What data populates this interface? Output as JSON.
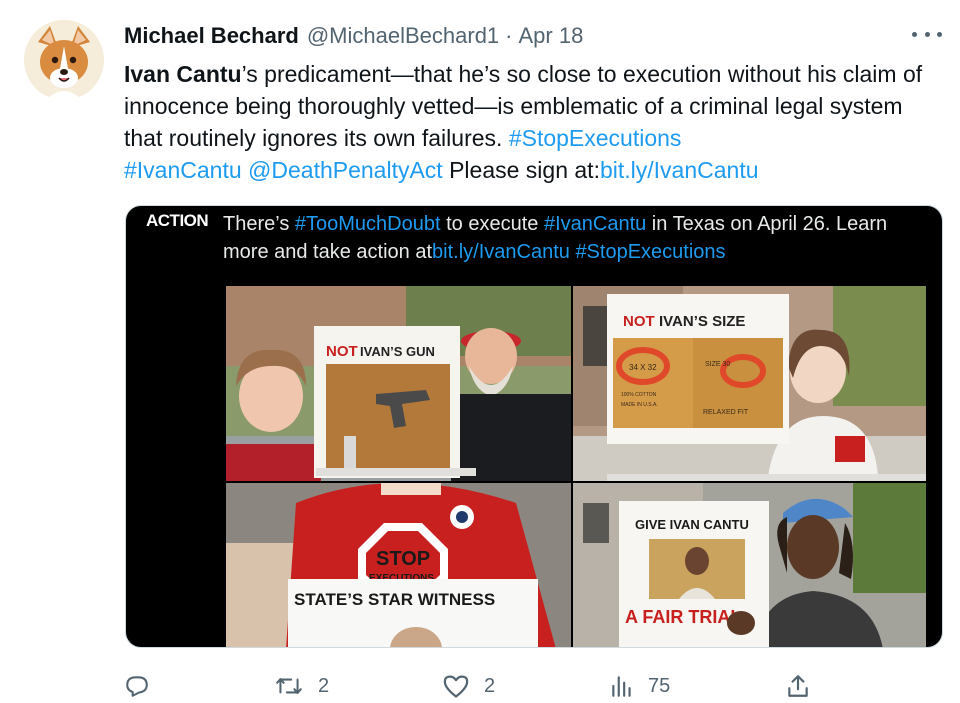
{
  "tweet": {
    "author_name": "Michael Bechard",
    "author_handle": "@MichaelBechard1",
    "separator": "·",
    "date": "Apr 18",
    "text": {
      "lead_bold": "Ivan Cantu",
      "body": "’s predicament—that he’s so close to execution without his claim of innocence being thoroughly vetted—is emblematic of a criminal legal system that routinely ignores its own failures. ",
      "hashtag1": "#StopExecutions",
      "hashtag2": "#IvanCantu",
      "mention": "@DeathPenaltyAct",
      "plain": " Please sign at:",
      "link": "bit.ly/IvanCantu"
    }
  },
  "media": {
    "logo": "ACTION",
    "caption": {
      "part1": "There’s ",
      "tag1": "#TooMuchDoubt",
      "part2": " to execute ",
      "tag2": "#IvanCantu",
      "part3": " in Texas on April 26.  Learn more and take action at",
      "link": "bit.ly/IvanCantu",
      "space": " ",
      "tag3": "#StopExecutions"
    },
    "signs": {
      "gun_not": "NOT",
      "gun_rest": " IVAN’S GUN",
      "size_not": "NOT",
      "size_rest": " IVAN’S SIZE",
      "label_size": "34 X 32",
      "label_line1": "100% COTTON",
      "label_line2": "MADE IN U.S.A.",
      "label_relaxed": "RELAXED FIT",
      "label_right": "SIZE 30",
      "stop_line1": "STOP",
      "stop_line2": "EXECUTIONS",
      "witness": "STATE’S STAR WITNESS",
      "fair_top": "GIVE IVAN CANTU",
      "fair_bottom": "A FAIR TRIAL"
    }
  },
  "actions": {
    "reply_count": "",
    "retweet_count": "2",
    "like_count": "2",
    "views_count": "75"
  },
  "colors": {
    "link": "#1d9bf0",
    "secondary": "#536471",
    "sign_red": "#c8201e"
  }
}
